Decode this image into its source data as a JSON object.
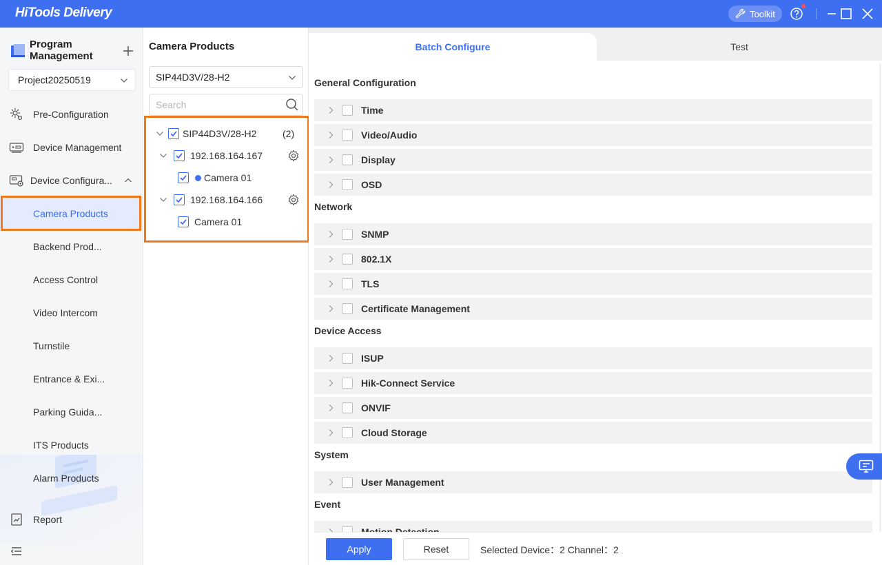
{
  "app": {
    "title": "HiTools Delivery",
    "toolkit_label": "Toolkit"
  },
  "sidebar": {
    "program_title": "Program Management",
    "project": "Project20250519",
    "items": [
      {
        "label": "Pre-Configuration",
        "icon": "gear-config-icon"
      },
      {
        "label": "Device Management",
        "icon": "device-icon"
      },
      {
        "label": "Device Configura...",
        "icon": "device-config-icon"
      },
      {
        "label": "Camera Products"
      },
      {
        "label": "Backend Prod..."
      },
      {
        "label": "Access Control"
      },
      {
        "label": "Video Intercom"
      },
      {
        "label": "Turnstile"
      },
      {
        "label": "Entrance & Exi..."
      },
      {
        "label": "Parking Guida..."
      },
      {
        "label": "ITS Products"
      },
      {
        "label": "Alarm Products"
      },
      {
        "label": "Report",
        "icon": "report-icon"
      }
    ]
  },
  "tree": {
    "title": "Camera Products",
    "model": "SIP44D3V/28-H2",
    "search_placeholder": "Search",
    "root": {
      "label": "SIP44D3V/28-H2",
      "count": "(2)"
    },
    "devices": [
      {
        "ip": "192.168.164.167",
        "channel": "Camera 01",
        "online": true
      },
      {
        "ip": "192.168.164.166",
        "channel": "Camera 01",
        "online": false
      }
    ]
  },
  "main": {
    "tabs": [
      "Batch Configure",
      "Test"
    ],
    "active_tab": "Batch Configure",
    "sections": [
      {
        "title": "General Configuration",
        "items": [
          "Time",
          "Video/Audio",
          "Display",
          "OSD"
        ]
      },
      {
        "title": "Network",
        "items": [
          "SNMP",
          "802.1X",
          "TLS",
          "Certificate Management"
        ]
      },
      {
        "title": "Device Access",
        "items": [
          "ISUP",
          "Hik-Connect Service",
          "ONVIF",
          "Cloud Storage"
        ]
      },
      {
        "title": "System",
        "items": [
          "User Management"
        ]
      },
      {
        "title": "Event",
        "items": [
          "Motion Detection"
        ]
      }
    ],
    "apply_label": "Apply",
    "reset_label": "Reset",
    "selected_info": "Selected Device：2 Channel：2"
  },
  "colors": {
    "accent": "#3d6ff0",
    "highlight": "#f07a1a",
    "row_bg": "#f2f2f2"
  }
}
